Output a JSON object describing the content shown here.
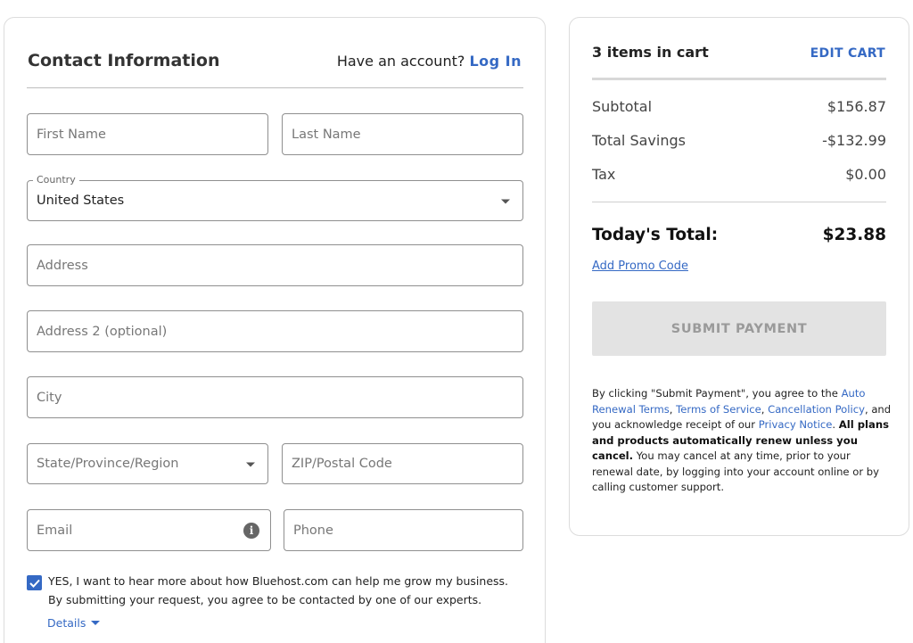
{
  "contact": {
    "title": "Contact Information",
    "account_prompt": "Have an account?",
    "login_label": "Log In"
  },
  "form": {
    "first_name_placeholder": "First Name",
    "last_name_placeholder": "Last Name",
    "country_label": "Country",
    "country_value": "United States",
    "address_placeholder": "Address",
    "address2_placeholder": "Address 2 (optional)",
    "city_placeholder": "City",
    "state_placeholder": "State/Province/Region",
    "zip_placeholder": "ZIP/Postal Code",
    "email_placeholder": "Email",
    "phone_placeholder": "Phone",
    "info_glyph": "i"
  },
  "consent": {
    "checked": true,
    "line1": "YES, I want to hear more about how Bluehost.com can help me grow my business.",
    "line2": "By submitting your request, you agree to be contacted by one of our experts.",
    "details_label": "Details"
  },
  "cart": {
    "count_label": "3 items in cart",
    "edit_label": "EDIT CART",
    "rows": [
      {
        "label": "Subtotal",
        "value": "$156.87"
      },
      {
        "label": "Total Savings",
        "value": "-$132.99"
      },
      {
        "label": "Tax",
        "value": "$0.00"
      }
    ],
    "total_label": "Today's Total:",
    "total_value": "$23.88",
    "promo_label": "Add Promo Code",
    "submit_label": "SUBMIT PAYMENT"
  },
  "legal": {
    "part1": "By clicking \"Submit Payment\", you agree to the ",
    "auto_renewal": "Auto Renewal Terms",
    "comma1": ", ",
    "terms": "Terms of Service",
    "comma2": ", ",
    "cancellation": "Cancellation Policy",
    "part2": ", and you acknowledge receipt of our ",
    "privacy": "Privacy Notice",
    "period": ". ",
    "bold": "All plans and products automatically renew unless you cancel.",
    "part3": " You may cancel at any time, prior to your renewal date, by logging into your account online or by calling customer support."
  },
  "colors": {
    "accent": "#3569c4",
    "submit_disabled_bg": "#e3e3e3",
    "submit_disabled_text": "#9a9a9a"
  }
}
